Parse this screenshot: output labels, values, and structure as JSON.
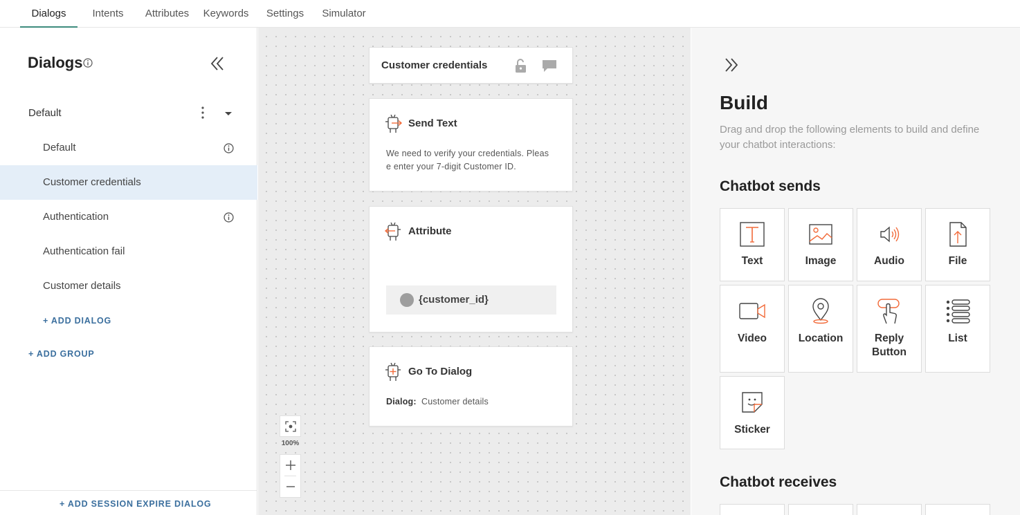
{
  "nav": {
    "tabs": [
      {
        "label": "Dialogs",
        "active": true
      },
      {
        "label": "Intents"
      },
      {
        "label": "Attributes"
      },
      {
        "label": "Keywords"
      },
      {
        "label": "Settings"
      },
      {
        "label": "Simulator"
      }
    ]
  },
  "sidebar": {
    "title": "Dialogs",
    "group": {
      "label": "Default"
    },
    "dialogs": [
      {
        "label": "Default",
        "info": true
      },
      {
        "label": "Customer credentials",
        "selected": true
      },
      {
        "label": "Authentication",
        "info": true
      },
      {
        "label": "Authentication fail"
      },
      {
        "label": "Customer details"
      }
    ],
    "add_dialog": "+ ADD DIALOG",
    "add_group": "+ ADD GROUP",
    "add_session_expire": "+ ADD SESSION EXPIRE DIALOG"
  },
  "canvas": {
    "header_title": "Customer credentials",
    "send_text": {
      "title": "Send Text",
      "line1": "We need to verify your credentials. Pleas",
      "line2": "e enter your 7-digit Customer ID."
    },
    "attribute": {
      "title": "Attribute",
      "value": "{customer_id}"
    },
    "go_to_dialog": {
      "title": "Go To Dialog",
      "dialog_label": "Dialog:",
      "dialog_value": "Customer details"
    },
    "zoom_level": "100%"
  },
  "build": {
    "title": "Build",
    "description": "Drag and drop the following elements to build and define your chatbot interactions:",
    "sends_title": "Chatbot sends",
    "sends_tiles": [
      {
        "label": "Text",
        "icon": "text-icon"
      },
      {
        "label": "Image",
        "icon": "image-icon"
      },
      {
        "label": "Audio",
        "icon": "audio-icon"
      },
      {
        "label": "File",
        "icon": "file-icon"
      },
      {
        "label": "Video",
        "icon": "video-icon"
      },
      {
        "label": "Location",
        "icon": "location-icon"
      },
      {
        "label": "Reply Button",
        "icon": "reply-button-icon"
      },
      {
        "label": "List",
        "icon": "list-icon"
      },
      {
        "label": "Sticker",
        "icon": "sticker-icon"
      }
    ],
    "receives_title": "Chatbot receives"
  },
  "colors": {
    "accent": "#f26b3a",
    "active_tab_underline": "#3d8b7d",
    "link": "#3b6f9e",
    "selected_row": "#e4eef8"
  }
}
